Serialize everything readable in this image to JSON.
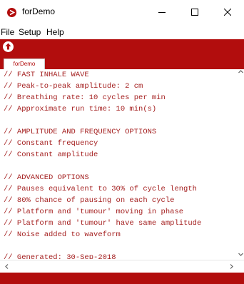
{
  "window": {
    "title": "forDemo"
  },
  "menu": {
    "items": [
      "File",
      "Setup",
      "Help"
    ]
  },
  "tabs": [
    "forDemo"
  ],
  "editor": {
    "lines": [
      "// FAST INHALE WAVE",
      "// Peak-to-peak amplitude: 2 cm",
      "// Breathing rate: 10 cycles per min",
      "// Approximate run time: 10 min(s)",
      "",
      "// AMPLITUDE AND FREQUENCY OPTIONS",
      "// Constant frequency",
      "// Constant amplitude",
      "",
      "// ADVANCED OPTIONS",
      "// Pauses equivalent to 30% of cycle length",
      "// 80% chance of pausing on each cycle",
      "// Platform and 'tumour' moving in phase",
      "// Platform and 'tumour' have same amplitude",
      "// Noise added to waveform",
      "",
      "// Generated: 30-Sep-2018"
    ]
  },
  "icons": {
    "app": "processing-app-icon",
    "toolbar": "upload-icon",
    "minimize": "minimize-icon",
    "maximize": "maximize-icon",
    "close": "close-icon"
  },
  "colors": {
    "accent": "#b20d0d",
    "code_text": "#a41f1f",
    "background": "#ffffff"
  }
}
